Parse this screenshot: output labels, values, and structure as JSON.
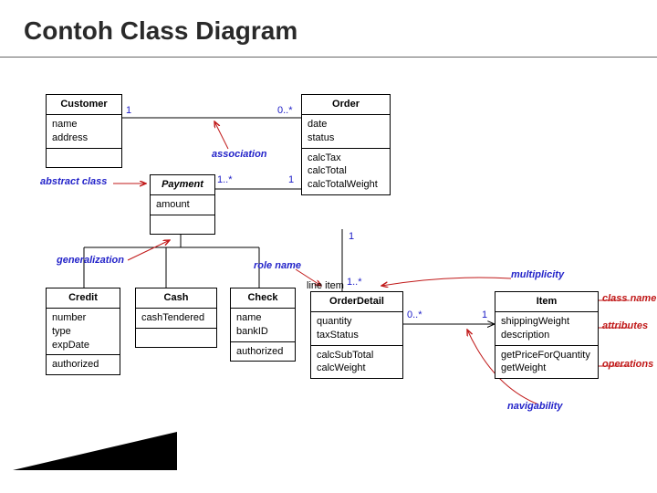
{
  "title": "Contoh Class Diagram",
  "classes": {
    "customer": {
      "name": "Customer",
      "attrs": [
        "name",
        "address"
      ],
      "ops": []
    },
    "payment": {
      "name": "Payment",
      "attrs": [
        "amount"
      ],
      "ops": []
    },
    "order": {
      "name": "Order",
      "attrs": [
        "date",
        "status"
      ],
      "ops": [
        "calcTax",
        "calcTotal",
        "calcTotalWeight"
      ]
    },
    "credit": {
      "name": "Credit",
      "attrs": [
        "number",
        "type",
        "expDate"
      ],
      "ops": [
        "authorized"
      ]
    },
    "cash": {
      "name": "Cash",
      "attrs": [
        "cashTendered"
      ],
      "ops": []
    },
    "check": {
      "name": "Check",
      "attrs": [
        "name",
        "bankID"
      ],
      "ops": [
        "authorized"
      ]
    },
    "orderdetail": {
      "name": "OrderDetail",
      "attrs": [
        "quantity",
        "taxStatus"
      ],
      "ops": [
        "calcSubTotal",
        "calcWeight"
      ]
    },
    "item": {
      "name": "Item",
      "attrs": [
        "shippingWeight",
        "description"
      ],
      "ops": [
        "getPriceForQuantity",
        "getWeight"
      ]
    }
  },
  "mult": {
    "cust_order_left": "1",
    "cust_order_right": "0..*",
    "pay_order_left": "1..*",
    "pay_order_right": "1",
    "order_detail_top": "1",
    "order_detail_bottom": "1..*",
    "detail_item_left": "0..*",
    "detail_item_right": "1"
  },
  "annotations": {
    "association": "association",
    "abstract_class": "abstract class",
    "generalization": "generalization",
    "role_name": "role name",
    "line_item": "line item",
    "multiplicity": "multiplicity",
    "class_name": "class name",
    "attributes": "attributes",
    "operations": "operations",
    "navigability": "navigability"
  }
}
